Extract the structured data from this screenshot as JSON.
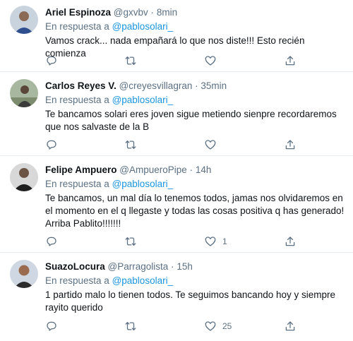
{
  "tweets": [
    {
      "name": "Ariel Espinoza",
      "handle": "@gxvbv",
      "dot": "·",
      "time": "8min",
      "reply_prefix": "En respuesta a",
      "reply_to": "@pablosolari_",
      "text": "Vamos crack... nada empañará lo que nos diste!!! Esto recién comienza",
      "like_count": "",
      "avatar_icon": "avatar-photo"
    },
    {
      "name": "Carlos Reyes V.",
      "handle": "@creyesvillagran",
      "dot": "·",
      "time": "35min",
      "reply_prefix": "En respuesta a",
      "reply_to": "@pablosolari_",
      "text": "Te bancamos solari eres joven sigue metiendo sienpre recordaremos que nos salvaste de la B",
      "like_count": "",
      "avatar_icon": "avatar-photo"
    },
    {
      "name": "Felipe Ampuero",
      "handle": "@AmpueroPipe",
      "dot": "·",
      "time": "14h",
      "reply_prefix": "En respuesta a",
      "reply_to": "@pablosolari_",
      "text": "Te bancamos, un mal día lo tenemos todos, jamas nos olvidaremos en el momento en el q llegaste y todas las cosas positiva q has generado! Arriba Pablito!!!!!!!",
      "like_count": "1",
      "avatar_icon": "avatar-photo"
    },
    {
      "name": "SuazoLocura",
      "handle": "@Parragolista",
      "dot": "·",
      "time": "15h",
      "reply_prefix": "En respuesta a",
      "reply_to": "@pablosolari_",
      "text": "1 partido malo lo tienen todos. Te seguimos bancando hoy y siempre rayito querido",
      "like_count": "25",
      "avatar_icon": "avatar-photo"
    }
  ],
  "icons": {
    "reply": "reply-icon",
    "retweet": "retweet-icon",
    "like": "heart-icon",
    "share": "share-icon"
  },
  "colors": {
    "text": "#0f1419",
    "secondary": "#5b7083",
    "mention": "#1b95e0",
    "border": "#e6ecf0"
  }
}
